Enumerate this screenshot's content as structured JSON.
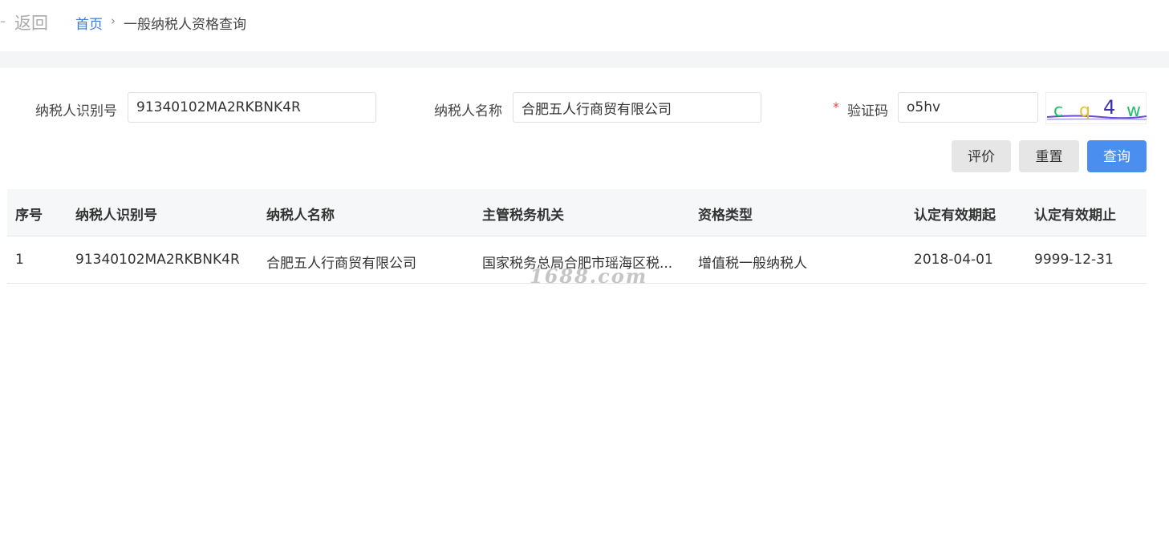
{
  "topbar": {
    "back_dash": "-",
    "back_label": "返回",
    "breadcrumb": {
      "home": "首页",
      "separator": "›",
      "current": "一般纳税人资格查询"
    }
  },
  "form": {
    "taxpayer_id_label": "纳税人识别号",
    "taxpayer_id_value": "91340102MA2RKBNK4R",
    "taxpayer_name_label": "纳税人名称",
    "taxpayer_name_value": "合肥五人行商贸有限公司",
    "required_mark": "*",
    "captcha_label": "验证码",
    "captcha_value": "o5hv",
    "captcha_image_text": "c q 4 w"
  },
  "buttons": {
    "evaluate": "评价",
    "reset": "重置",
    "query": "查询"
  },
  "table": {
    "columns": [
      "序号",
      "纳税人识别号",
      "纳税人名称",
      "主管税务机关",
      "资格类型",
      "认定有效期起",
      "认定有效期止"
    ],
    "rows": [
      [
        "1",
        "91340102MA2RKBNK4R",
        "合肥五人行商贸有限公司",
        "国家税务总局合肥市瑶海区税...",
        "增值税一般纳税人",
        "2018-04-01",
        "9999-12-31"
      ]
    ]
  },
  "watermark": "1688.com",
  "colors": {
    "link": "#3b7cd9",
    "primary": "#4a8ef0",
    "required": "#e44444",
    "header_bg": "#f6f7f9"
  }
}
